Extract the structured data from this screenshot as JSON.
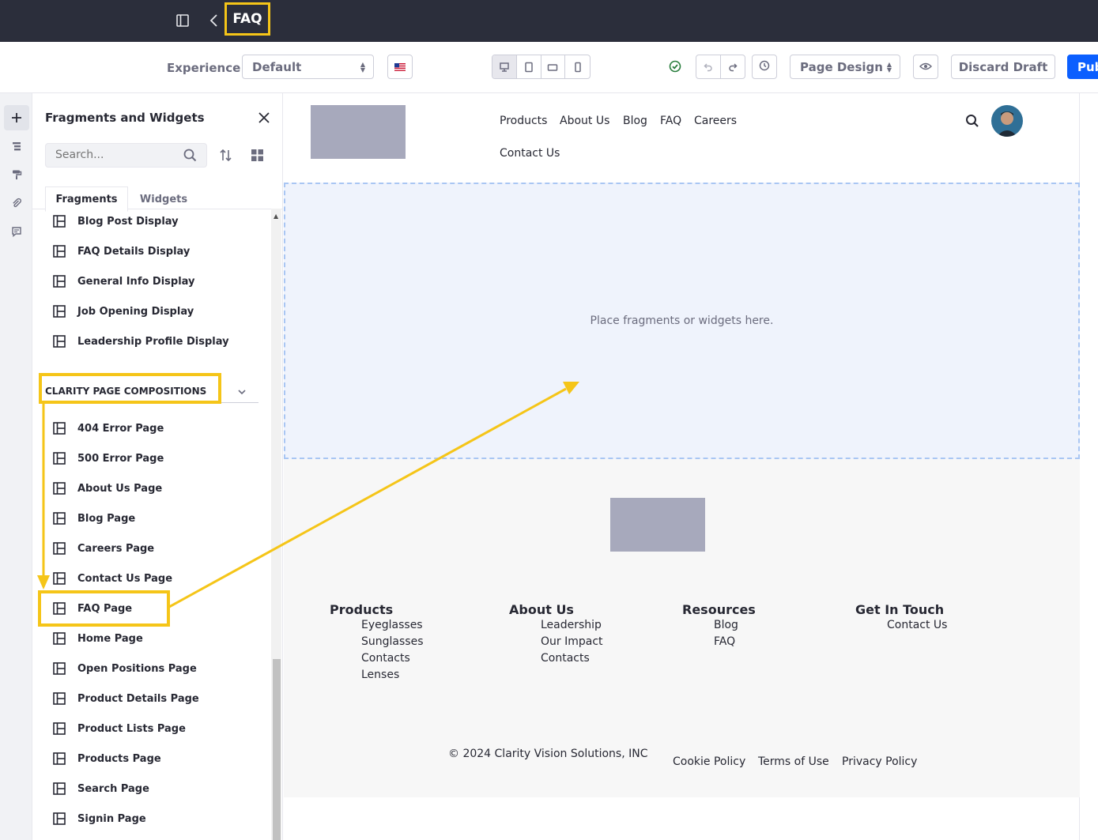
{
  "topbar": {
    "title": "FAQ"
  },
  "toolbar": {
    "experience_label": "Experience",
    "experience_value": "Default",
    "mode_value": "Page Design",
    "discard_label": "Discard Draft",
    "publish_label": "Pub"
  },
  "panel": {
    "title": "Fragments and Widgets",
    "search_placeholder": "Search...",
    "tabs": [
      "Fragments",
      "Widgets"
    ],
    "items_top": [
      "Blog Post Display",
      "FAQ Details Display",
      "General Info Display",
      "Job Opening Display",
      "Leadership Profile Display"
    ],
    "section_title": "CLARITY PAGE COMPOSITIONS",
    "compositions": [
      "404 Error Page",
      "500 Error Page",
      "About Us Page",
      "Blog Page",
      "Careers Page",
      "Contact Us Page",
      "FAQ Page",
      "Home Page",
      "Open Positions Page",
      "Product Details Page",
      "Product Lists Page",
      "Products Page",
      "Search Page",
      "Signin Page"
    ]
  },
  "canvas": {
    "nav": [
      "Products",
      "About Us",
      "Blog",
      "FAQ",
      "Careers",
      "Contact Us"
    ],
    "drop_text": "Place fragments or widgets here.",
    "footer": {
      "columns": [
        {
          "heading": "Products",
          "links": [
            "Eyeglasses",
            "Sunglasses",
            "Contacts",
            "Lenses"
          ]
        },
        {
          "heading": "About Us",
          "links": [
            "Leadership",
            "Our Impact",
            "Contacts"
          ]
        },
        {
          "heading": "Resources",
          "links": [
            "Blog",
            "FAQ"
          ]
        },
        {
          "heading": "Get In Touch",
          "links": [
            "Contact Us"
          ]
        }
      ],
      "copyright": "© 2024 Clarity Vision Solutions, INC",
      "legal": [
        "Cookie Policy",
        "Terms of Use",
        "Privacy Policy"
      ]
    }
  },
  "colors": {
    "highlight": "#f5c518",
    "topbar_bg": "#2b2e3b",
    "publish_bg": "#0b5fff",
    "success": "#287d3c"
  }
}
